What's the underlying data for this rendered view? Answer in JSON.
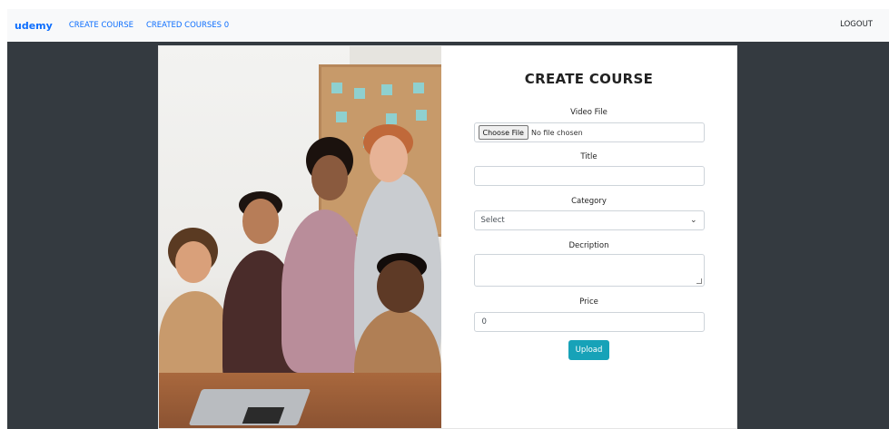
{
  "navbar": {
    "brand": "udemy",
    "links": [
      "CREATE COURSE",
      "CREATED COURSES 0"
    ],
    "logout": "LOGOUT"
  },
  "form": {
    "title": "CREATE COURSE",
    "video_label": "Video File",
    "file_button": "Choose File",
    "file_status": "No file chosen",
    "title_label": "Title",
    "title_value": "",
    "category_label": "Category",
    "category_value": "Select",
    "description_label": "Decription",
    "description_value": "",
    "price_label": "Price",
    "price_value": "0",
    "upload_button": "Upload"
  },
  "colors": {
    "brand": "#0d6efd",
    "navbar_bg": "#f8f9fa",
    "page_bg": "#343a40",
    "upload_button": "#17a2b8"
  },
  "icons": {
    "select_chevron": "chevron-down-icon"
  }
}
